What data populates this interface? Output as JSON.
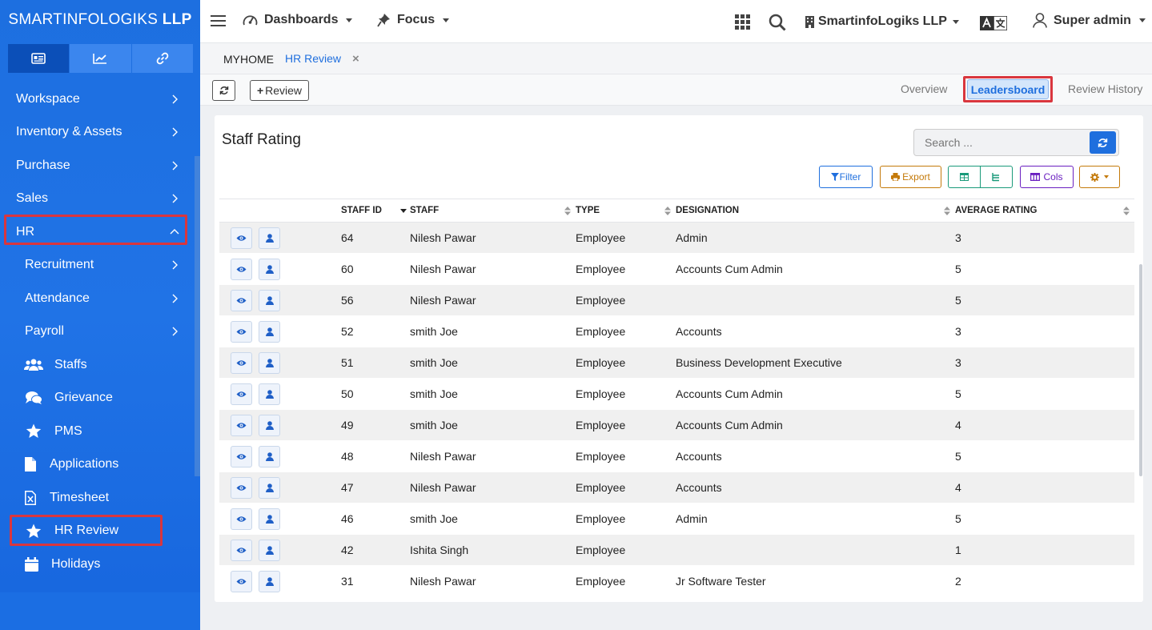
{
  "brand": {
    "name_light": "SMARTINFOLOGIKS",
    "name_bold": "LLP"
  },
  "sidebar": {
    "tabs": [
      {
        "icon": "id-card-icon"
      },
      {
        "icon": "chart-line-icon"
      },
      {
        "icon": "link-icon"
      }
    ],
    "items": [
      {
        "label": "Workspace"
      },
      {
        "label": "Inventory & Assets"
      },
      {
        "label": "Purchase"
      },
      {
        "label": "Sales"
      },
      {
        "label": "HR"
      },
      {
        "label": "Recruitment"
      },
      {
        "label": "Attendance"
      },
      {
        "label": "Payroll"
      },
      {
        "label": "Staffs"
      },
      {
        "label": "Grievance"
      },
      {
        "label": "PMS"
      },
      {
        "label": "Applications"
      },
      {
        "label": "Timesheet"
      },
      {
        "label": "HR Review"
      },
      {
        "label": "Holidays"
      }
    ]
  },
  "topbar": {
    "dashboards": "Dashboards",
    "focus": "Focus",
    "company": "SmartinfoLogiks LLP",
    "user": "Super admin"
  },
  "crumbs": {
    "home": "MYHOME",
    "current": "HR Review",
    "close": "×"
  },
  "toolbar": {
    "review_label": "Review",
    "tabs": [
      "Overview",
      "Leadersboard",
      "Review History"
    ]
  },
  "card": {
    "title": "Staff Rating",
    "search_placeholder": "Search ...",
    "filter_label": "Filter",
    "export_label": "Export",
    "cols_label": "Cols"
  },
  "table": {
    "headers": [
      "STAFF ID",
      "STAFF",
      "TYPE",
      "DESIGNATION",
      "AVERAGE RATING"
    ],
    "rows": [
      {
        "id": "64",
        "staff": "Nilesh Pawar",
        "type": "Employee",
        "designation": "Admin",
        "rating": "3"
      },
      {
        "id": "60",
        "staff": "Nilesh Pawar",
        "type": "Employee",
        "designation": "Accounts Cum Admin",
        "rating": "5"
      },
      {
        "id": "56",
        "staff": "Nilesh Pawar",
        "type": "Employee",
        "designation": "",
        "rating": "5"
      },
      {
        "id": "52",
        "staff": "smith Joe",
        "type": "Employee",
        "designation": "Accounts",
        "rating": "3"
      },
      {
        "id": "51",
        "staff": "smith Joe",
        "type": "Employee",
        "designation": "Business Development Executive",
        "rating": "3"
      },
      {
        "id": "50",
        "staff": "smith Joe",
        "type": "Employee",
        "designation": "Accounts Cum Admin",
        "rating": "5"
      },
      {
        "id": "49",
        "staff": "smith Joe",
        "type": "Employee",
        "designation": "Accounts Cum Admin",
        "rating": "4"
      },
      {
        "id": "48",
        "staff": "Nilesh Pawar",
        "type": "Employee",
        "designation": "Accounts",
        "rating": "5"
      },
      {
        "id": "47",
        "staff": "Nilesh Pawar",
        "type": "Employee",
        "designation": "Accounts",
        "rating": "4"
      },
      {
        "id": "46",
        "staff": "smith Joe",
        "type": "Employee",
        "designation": "Admin",
        "rating": "5"
      },
      {
        "id": "42",
        "staff": "Ishita Singh",
        "type": "Employee",
        "designation": "",
        "rating": "1"
      },
      {
        "id": "31",
        "staff": "Nilesh Pawar",
        "type": "Employee",
        "designation": "Jr Software Tester",
        "rating": "2"
      }
    ]
  },
  "colors": {
    "primary": "#1f6fde",
    "highlight": "#d9363e",
    "filter": "#1f6fde",
    "export": "#c47a0a",
    "cols": "#6a1fc0",
    "grid": "#1a9a7a"
  }
}
